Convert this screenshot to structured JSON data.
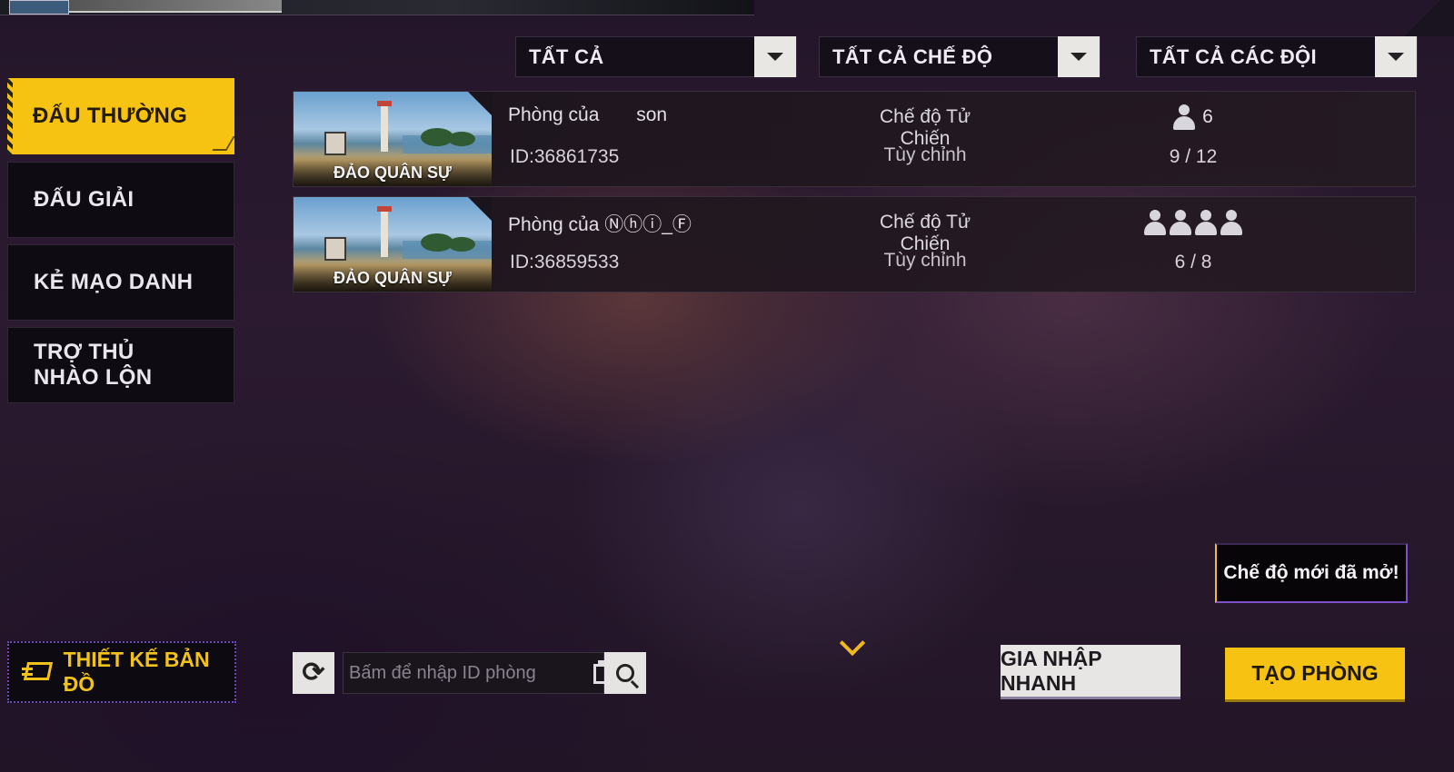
{
  "filters": [
    {
      "label": "TẤT CẢ"
    },
    {
      "label": "TẤT CẢ CHẾ ĐỘ"
    },
    {
      "label": "TẤT CẢ CÁC ĐỘI"
    }
  ],
  "tabs": [
    {
      "label": "ĐẤU THƯỜNG",
      "active": true
    },
    {
      "label": "ĐẤU GIẢI"
    },
    {
      "label": "KẺ MẠO DANH"
    },
    {
      "label": "TRỢ THỦ NHÀO LỘN"
    }
  ],
  "rooms": [
    {
      "map": "ĐẢO QUÂN SỰ",
      "owner": "Phòng của       son",
      "id": "ID:36861735",
      "mode": "Chế độ Tử Chiến",
      "custom": "Tùy chỉnh",
      "team_count": "6",
      "capacity": "9 / 12"
    },
    {
      "map": "ĐẢO QUÂN SỰ",
      "owner": "Phòng của ⓃⓗⓘⒻ",
      "owner_display": "Phòng của Ⓝⓗⓘ_Ⓕ",
      "id": "ID:36859533",
      "mode": "Chế độ Tử Chiến",
      "custom": "Tùy chỉnh",
      "team_icons": 4,
      "capacity": "6 / 8"
    }
  ],
  "notice": "Chế độ mới đã mở!",
  "map_design": "THIẾT KẾ BẢN ĐỒ",
  "search": {
    "placeholder": "Bấm để nhập ID phòng"
  },
  "quick_join": "GIA NHẬP NHANH",
  "create_room": "TẠO PHÒNG",
  "colors": {
    "accent": "#f6c312",
    "panel": "#150f19",
    "notice_border": "#7b52c9"
  },
  "icons": [
    "chevron-down-icon",
    "person-icon",
    "map-design-icon",
    "refresh-icon",
    "paste-icon",
    "search-icon"
  ]
}
